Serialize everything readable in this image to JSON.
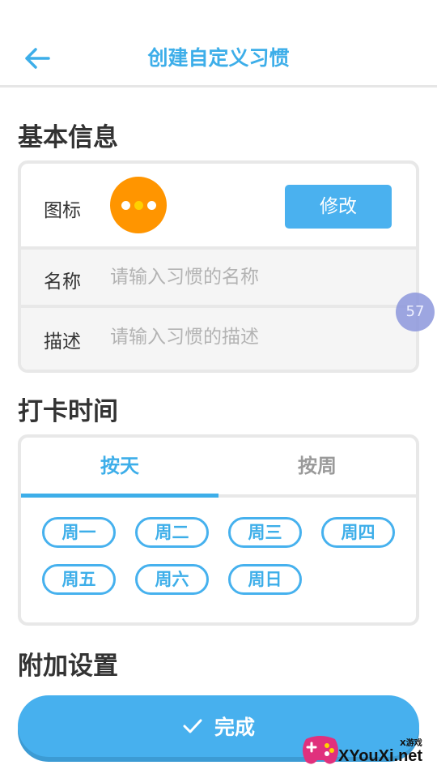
{
  "header": {
    "title": "创建自定义习惯",
    "back_icon": "arrow-left-icon"
  },
  "basic_info": {
    "section_title": "基本信息",
    "icon_label": "图标",
    "icon_color": "#ff9500",
    "edit_label": "修改",
    "name_label": "名称",
    "name_placeholder": "请输入习惯的名称",
    "name_value": "",
    "desc_label": "描述",
    "desc_placeholder": "请输入习惯的描述",
    "desc_value": ""
  },
  "punch_time": {
    "section_title": "打卡时间",
    "tabs": [
      {
        "label": "按天",
        "active": true
      },
      {
        "label": "按周",
        "active": false
      }
    ],
    "days": [
      "周一",
      "周二",
      "周三",
      "周四",
      "周五",
      "周六",
      "周日"
    ]
  },
  "extra": {
    "section_title": "附加设置"
  },
  "finish": {
    "label": "完成",
    "icon": "check-icon"
  },
  "floating_badge": {
    "value": "57"
  },
  "watermark": {
    "small_text": "X游戏",
    "text": "XYouXi.net"
  },
  "colors": {
    "accent": "#3daee9",
    "button": "#4ab1ef",
    "icon_orange": "#ff9500"
  }
}
